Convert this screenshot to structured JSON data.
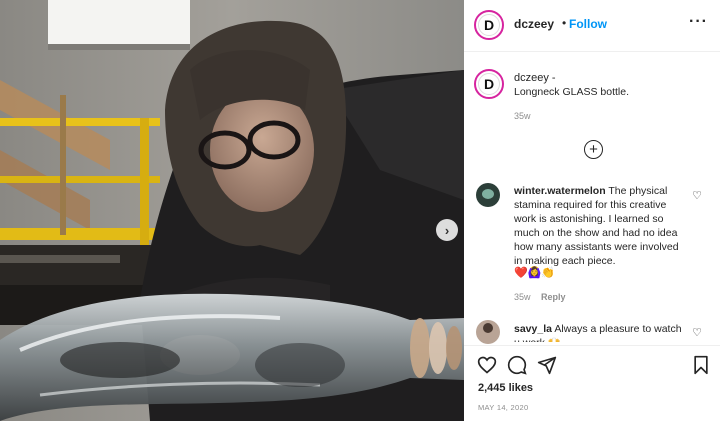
{
  "post": {
    "username": "dczeey",
    "separator": "•",
    "follow_label": "Follow",
    "more_icon": "more-options-icon",
    "avatar_letter": "D"
  },
  "caption": {
    "username": "dczeey",
    "suffix": "-",
    "text": "Longneck GLASS bottle.",
    "time": "35w"
  },
  "comments": [
    {
      "username": "winter.watermelon",
      "text": "The physical stamina required for this creative work is astonishing. I learned so much on the show and had no idea how many assistants were involved in making each piece.",
      "emoji": "❤️🙆‍♀️👏",
      "time": "35w",
      "reply_label": "Reply"
    },
    {
      "username": "savy_la",
      "text": "Always a pleasure to watch u work 🙌"
    }
  ],
  "engagement": {
    "likes": "2,445 likes",
    "date": "MAY 14, 2020"
  },
  "colors": {
    "follow": "#0095f6",
    "meta": "#8e8e8e",
    "avatar_ring": "#d6249f"
  },
  "icons": {
    "like": "heart-icon",
    "comment": "comment-icon",
    "share": "share-icon",
    "save": "bookmark-icon",
    "load_more": "plus-circle-icon",
    "next": "chevron-right-icon"
  }
}
